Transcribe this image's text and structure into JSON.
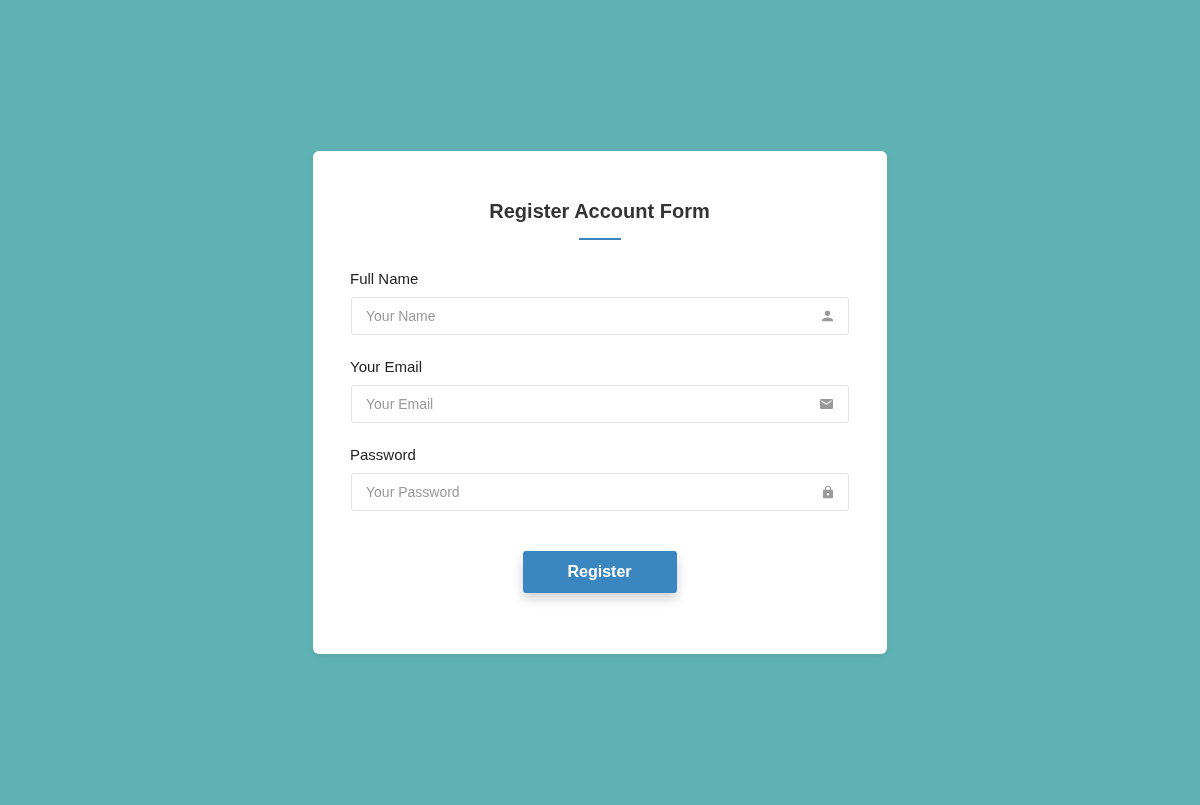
{
  "form": {
    "title": "Register Account Form",
    "fields": [
      {
        "label": "Full Name",
        "placeholder": "Your Name",
        "kind": "person"
      },
      {
        "label": "Your Email",
        "placeholder": "Your Email",
        "kind": "email"
      },
      {
        "label": "Password",
        "placeholder": "Your Password",
        "kind": "password"
      }
    ],
    "submit_button": "Register"
  }
}
